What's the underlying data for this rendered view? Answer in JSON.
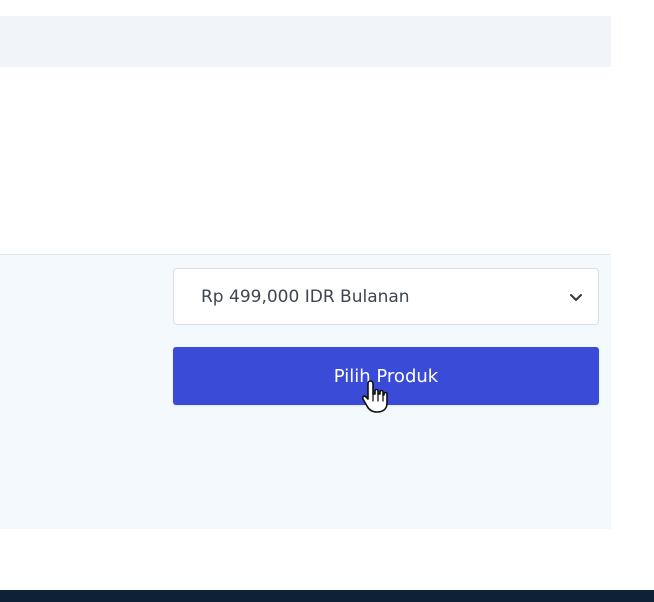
{
  "product": {
    "price_option": "Rp 499,000 IDR Bulanan",
    "choose_button_label": "Pilih Produk"
  },
  "icons": {
    "dropdown": "chevron-down-icon",
    "pointer": "hand-cursor-icon"
  },
  "colors": {
    "button": "#3a4bd8",
    "panel": "#f3f9fd",
    "footer": "#0f2235"
  }
}
